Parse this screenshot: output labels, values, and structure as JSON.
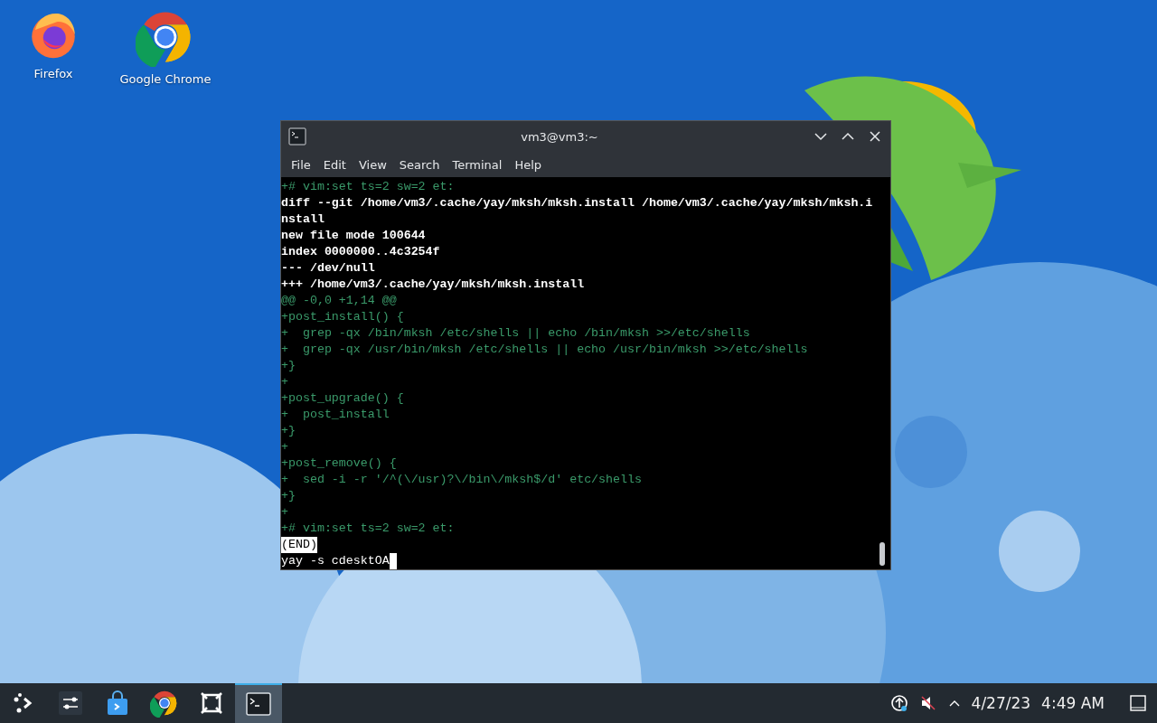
{
  "desktop_icons": [
    {
      "kind": "firefox",
      "label": "Firefox"
    },
    {
      "kind": "chrome",
      "label": "Google Chrome"
    }
  ],
  "window": {
    "title": "vm3@vm3:~",
    "menu": [
      "File",
      "Edit",
      "View",
      "Search",
      "Terminal",
      "Help"
    ],
    "lines": [
      {
        "kind": "diff",
        "text": "+# vim:set ts=2 sw=2 et:"
      },
      {
        "kind": "bold",
        "text": "diff --git /home/vm3/.cache/yay/mksh/mksh.install /home/vm3/.cache/yay/mksh/mksh.i"
      },
      {
        "kind": "bold",
        "text": "nstall"
      },
      {
        "kind": "bold",
        "text": "new file mode 100644"
      },
      {
        "kind": "bold",
        "text": "index 0000000..4c3254f"
      },
      {
        "kind": "bold",
        "text": "--- /dev/null"
      },
      {
        "kind": "bold",
        "text": "+++ /home/vm3/.cache/yay/mksh/mksh.install"
      },
      {
        "kind": "diff",
        "text": "@@ -0,0 +1,14 @@"
      },
      {
        "kind": "diff",
        "text": "+post_install() {"
      },
      {
        "kind": "diff",
        "text": "+  grep -qx /bin/mksh /etc/shells || echo /bin/mksh >>/etc/shells"
      },
      {
        "kind": "diff",
        "text": "+  grep -qx /usr/bin/mksh /etc/shells || echo /usr/bin/mksh >>/etc/shells"
      },
      {
        "kind": "diff",
        "text": "+}"
      },
      {
        "kind": "diff",
        "text": "+"
      },
      {
        "kind": "diff",
        "text": "+post_upgrade() {"
      },
      {
        "kind": "diff",
        "text": "+  post_install"
      },
      {
        "kind": "diff",
        "text": "+}"
      },
      {
        "kind": "diff",
        "text": "+"
      },
      {
        "kind": "diff",
        "text": "+post_remove() {"
      },
      {
        "kind": "diff",
        "text": "+  sed -i -r '/^(\\/usr)?\\/bin\\/mksh$/d' etc/shells"
      },
      {
        "kind": "diff",
        "text": "+}"
      },
      {
        "kind": "diff",
        "text": "+"
      },
      {
        "kind": "diff",
        "text": "+# vim:set ts=2 sw=2 et:"
      },
      {
        "kind": "status",
        "text": "(END)"
      },
      {
        "kind": "prompt",
        "text": "yay -s cdesktOA"
      }
    ]
  },
  "taskbar": {
    "tasks": [
      {
        "kind": "launcher",
        "selected": false
      },
      {
        "kind": "settings",
        "selected": false
      },
      {
        "kind": "store",
        "selected": false
      },
      {
        "kind": "chrome",
        "selected": false
      },
      {
        "kind": "window-manager",
        "selected": false
      },
      {
        "kind": "terminal",
        "selected": true
      }
    ],
    "date": "4/27/23",
    "time": "4:49 AM"
  }
}
